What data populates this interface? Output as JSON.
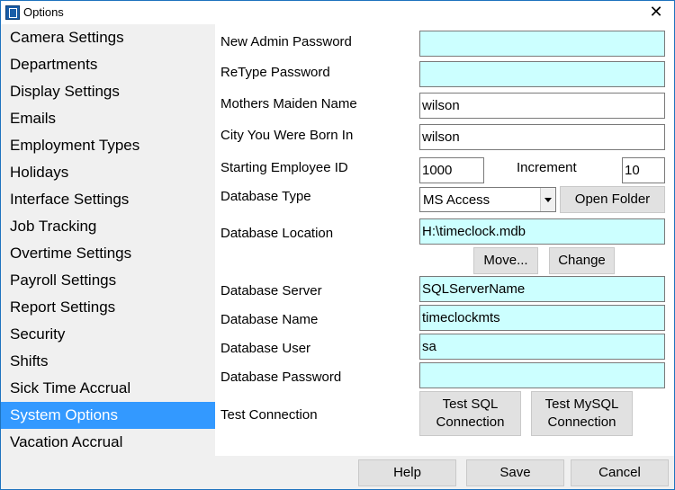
{
  "window": {
    "title": "Options",
    "close_glyph": "✕"
  },
  "sidebar": {
    "items": [
      {
        "label": "Camera Settings"
      },
      {
        "label": "Departments"
      },
      {
        "label": "Display Settings"
      },
      {
        "label": "Emails"
      },
      {
        "label": "Employment Types"
      },
      {
        "label": "Holidays"
      },
      {
        "label": "Interface Settings"
      },
      {
        "label": "Job Tracking"
      },
      {
        "label": "Overtime Settings"
      },
      {
        "label": "Payroll Settings"
      },
      {
        "label": "Report Settings"
      },
      {
        "label": "Security"
      },
      {
        "label": "Shifts"
      },
      {
        "label": "Sick Time Accrual"
      },
      {
        "label": "System Options"
      },
      {
        "label": "Vacation Accrual"
      }
    ],
    "selected": "System Options"
  },
  "form": {
    "new_admin_password": {
      "label": "New Admin Password",
      "value": ""
    },
    "retype_password": {
      "label": "ReType Password",
      "value": ""
    },
    "mothers_maiden_name": {
      "label": "Mothers Maiden Name",
      "value": "wilson"
    },
    "city_born_in": {
      "label": "City You Were Born In",
      "value": "wilson"
    },
    "starting_employee_id": {
      "label": "Starting Employee ID",
      "value": "1000"
    },
    "increment": {
      "label": "Increment",
      "value": "10"
    },
    "database_type": {
      "label": "Database Type",
      "value": "MS Access"
    },
    "open_folder_button": "Open Folder",
    "database_location": {
      "label": "Database Location",
      "value": "H:\\timeclock.mdb"
    },
    "move_button": "Move...",
    "change_button": "Change",
    "database_server": {
      "label": "Database Server",
      "value": "SQLServerName"
    },
    "database_name": {
      "label": "Database Name",
      "value": "timeclockmts"
    },
    "database_user": {
      "label": "Database User",
      "value": "sa"
    },
    "database_password": {
      "label": "Database Password",
      "value": ""
    },
    "test_connection": {
      "label": "Test Connection"
    },
    "test_sql_button": {
      "line1": "Test SQL",
      "line2": "Connection"
    },
    "test_mysql_button": {
      "line1": "Test MySQL",
      "line2": "Connection"
    }
  },
  "footer": {
    "help_button": "Help",
    "save_button": "Save",
    "cancel_button": "Cancel"
  },
  "colors": {
    "selected_bg": "#3399ff",
    "field_cyan": "#ccffff",
    "sidebar_bg": "#f0f0f0",
    "button_bg": "#e1e1e1"
  }
}
